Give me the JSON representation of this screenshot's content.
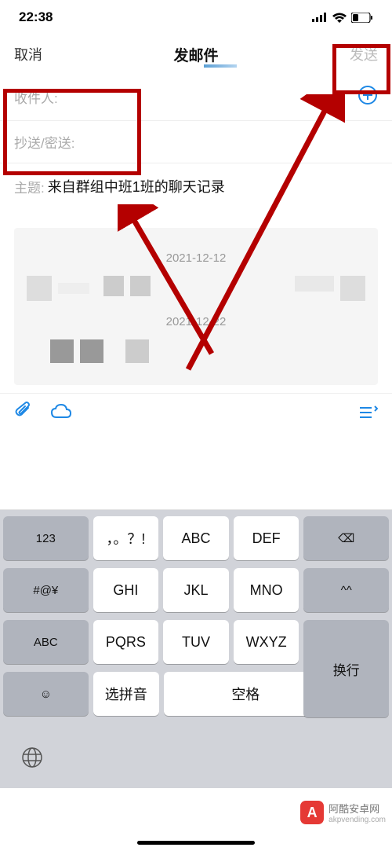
{
  "status": {
    "time": "22:38",
    "signal": "••ll",
    "wifi": "wifi",
    "battery": "low"
  },
  "nav": {
    "cancel": "取消",
    "title": "发邮件",
    "send": "发送"
  },
  "fields": {
    "to": "收件人:",
    "cc": "抄送/密送:",
    "subject_label": "主题:",
    "subject": "来自群组中班1班的聊天记录"
  },
  "body": {
    "date1": "2021-12-12",
    "date2": "2021-12-22"
  },
  "keyboard": {
    "row1": [
      "123",
      "，。？!",
      "ABC",
      "DEF"
    ],
    "row2": [
      "#@¥",
      "GHI",
      "JKL",
      "MNO"
    ],
    "row3": [
      "ABC",
      "PQRS",
      "TUV",
      "WXYZ"
    ],
    "row4": {
      "emoji": "☺",
      "pinyin": "选拼音",
      "space": "空格",
      "return": "换行"
    },
    "backspace": "⌫",
    "caret": "^^"
  },
  "watermark": {
    "brand": "阿酷安卓网",
    "url": "akpvending.com",
    "logo": "A"
  }
}
